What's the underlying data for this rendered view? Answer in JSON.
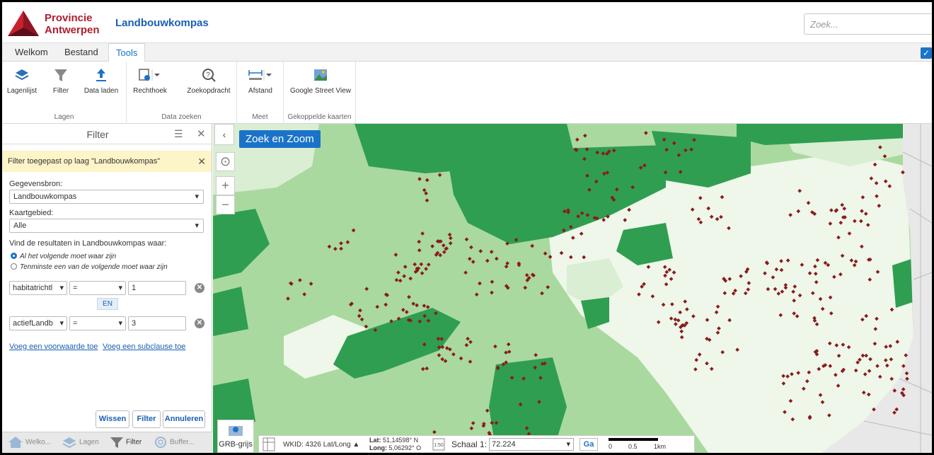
{
  "header": {
    "logo_line1": "Provincie",
    "logo_line2": "Antwerpen",
    "app_title": "Landbouwkompas",
    "search_placeholder": "Zoek..."
  },
  "menu": {
    "tabs": [
      {
        "label": "Welkom"
      },
      {
        "label": "Bestand"
      },
      {
        "label": "Tools",
        "active": true
      }
    ]
  },
  "ribbon": {
    "groups": [
      {
        "label": "Lagen",
        "buttons": [
          {
            "label": "Lagenlijst",
            "icon": "layers-icon"
          },
          {
            "label": "Filter",
            "icon": "filter-icon"
          },
          {
            "label": "Data laden",
            "icon": "upload-icon"
          }
        ]
      },
      {
        "label": "Data zoeken",
        "buttons": [
          {
            "label": "Rechthoek",
            "icon": "rectangle-select-icon"
          },
          {
            "label": "Zoekopdracht",
            "icon": "query-icon"
          }
        ]
      },
      {
        "label": "Meet",
        "buttons": [
          {
            "label": "Afstand",
            "icon": "measure-distance-icon"
          }
        ]
      },
      {
        "label": "Gekoppelde kaarten",
        "buttons": [
          {
            "label": "Google Street View",
            "icon": "street-view-icon"
          }
        ]
      }
    ]
  },
  "panel": {
    "title": "Filter",
    "banner": "Filter toegepast op laag \"Landbouwkompas\"",
    "datasource_label": "Gegevensbron:",
    "datasource_value": "Landbouwkompas",
    "area_label": "Kaartgebied:",
    "area_value": "Alle",
    "find_label": "Vind de resultaten in Landbouwkompas waar:",
    "radio_all": "Al het volgende moet waar zijn",
    "radio_any": "Tenminste een van de volgende moet waar zijn",
    "conditions": [
      {
        "field": "habitatrichtl",
        "operator": "=",
        "value": "1"
      },
      {
        "field": "actiefLandb",
        "operator": "=",
        "value": "3"
      }
    ],
    "connector": "EN",
    "add_condition": "Voeg een voorwaarde toe",
    "add_subclause": "Voeg een subclause toe",
    "btn_clear": "Wissen",
    "btn_filter": "Filter",
    "btn_cancel": "Annuleren"
  },
  "bottom_tabs": [
    {
      "label": "Welko...",
      "icon": "home-icon"
    },
    {
      "label": "Lagen",
      "icon": "layers-icon"
    },
    {
      "label": "Filter",
      "icon": "filter-icon",
      "active": true
    },
    {
      "label": "Buffer...",
      "icon": "buffer-icon"
    }
  ],
  "map": {
    "search_zoom_label": "Zoek en Zoom",
    "basemap_label": "GRB-grijs",
    "wkid": "WKID: 4326 Lat/Long ▲",
    "lat_label": "Lat:",
    "lat_value": "51,14598° N",
    "long_label": "Long:",
    "long_value": "5,06292° O",
    "scale_label": "Schaal 1:",
    "scale_value": "72.224",
    "go_label": "Ga",
    "scalebar_ticks": [
      "0",
      "0.5",
      "1km"
    ],
    "colors": {
      "dark_green": "#2f9e50",
      "mid_green": "#a9d99e",
      "light_green": "#d9eed3",
      "pale": "#eef7ea",
      "points": "#8b1a1a"
    }
  }
}
